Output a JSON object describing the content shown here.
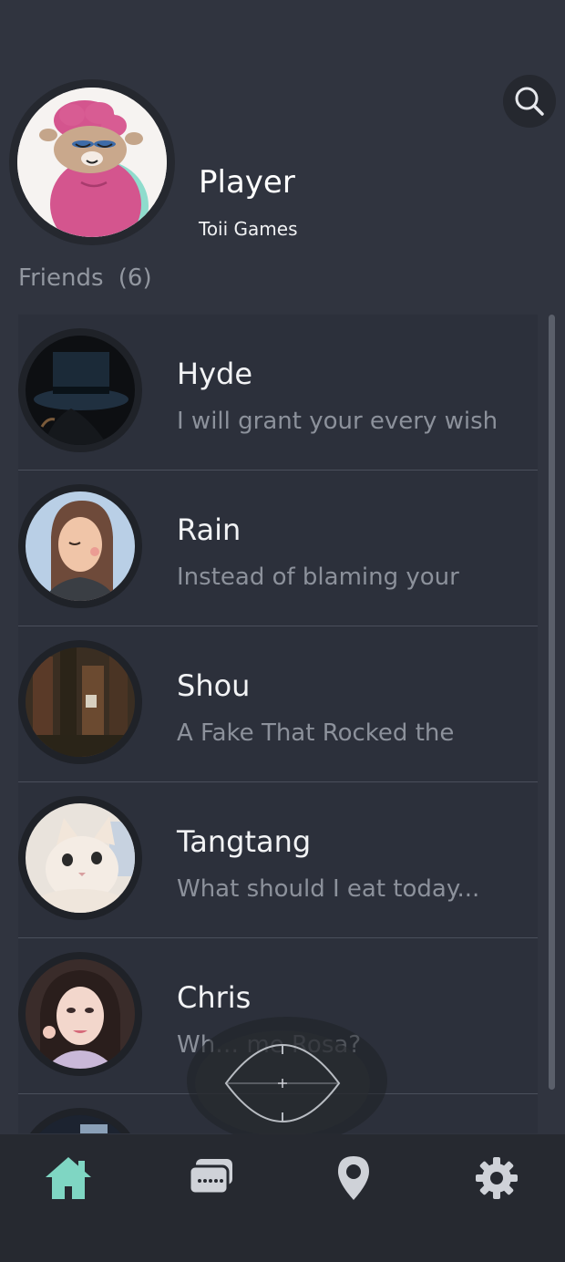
{
  "header": {
    "search_icon": "search-icon"
  },
  "profile": {
    "name": "Player",
    "subtitle": "Toii Games",
    "avatar": "alpaca-avatar"
  },
  "friends": {
    "header_label": "Friends",
    "count": "(6)",
    "items": [
      {
        "name": "Hyde",
        "status": "I will grant your every wish",
        "avatar": "top-hat-avatar"
      },
      {
        "name": "Rain",
        "status": "Instead of blaming your",
        "avatar": "girl-illustration-avatar"
      },
      {
        "name": "Shou",
        "status": "A Fake That Rocked the",
        "avatar": "ruins-photo-avatar"
      },
      {
        "name": "Tangtang",
        "status": "What should I eat today...",
        "avatar": "cat-photo-avatar"
      },
      {
        "name": "Chris",
        "status": "Wh… me Rosa?",
        "avatar": "woman-photo-avatar"
      },
      {
        "name": "",
        "status": "",
        "avatar": "partial-avatar"
      }
    ]
  },
  "nav": {
    "items": [
      {
        "icon": "home-icon",
        "active": true
      },
      {
        "icon": "chat-icon",
        "active": false
      },
      {
        "icon": "location-pin-icon",
        "active": false
      },
      {
        "icon": "settings-gear-icon",
        "active": false
      }
    ]
  },
  "colors": {
    "background": "#30343f",
    "nav_background": "#262930",
    "active_nav": "#7fd6c3",
    "inactive_nav": "#cfd2d8",
    "secondary_text": "#8c919b"
  }
}
